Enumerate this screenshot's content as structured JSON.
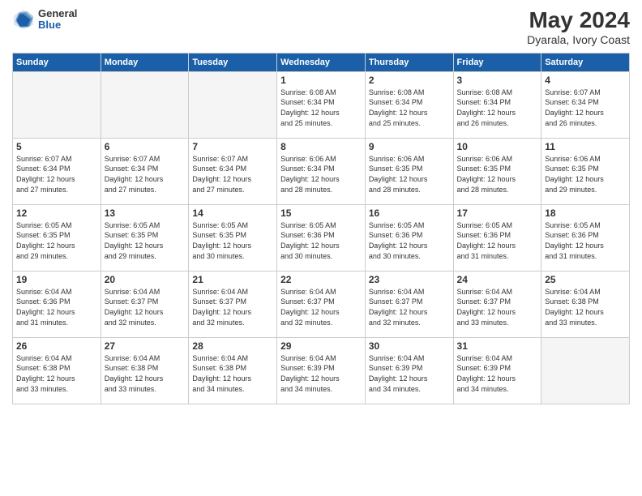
{
  "logo": {
    "general": "General",
    "blue": "Blue"
  },
  "title": "May 2024",
  "subtitle": "Dyarala, Ivory Coast",
  "days_of_week": [
    "Sunday",
    "Monday",
    "Tuesday",
    "Wednesday",
    "Thursday",
    "Friday",
    "Saturday"
  ],
  "weeks": [
    [
      {
        "day": "",
        "info": ""
      },
      {
        "day": "",
        "info": ""
      },
      {
        "day": "",
        "info": ""
      },
      {
        "day": "1",
        "info": "Sunrise: 6:08 AM\nSunset: 6:34 PM\nDaylight: 12 hours\nand 25 minutes."
      },
      {
        "day": "2",
        "info": "Sunrise: 6:08 AM\nSunset: 6:34 PM\nDaylight: 12 hours\nand 25 minutes."
      },
      {
        "day": "3",
        "info": "Sunrise: 6:08 AM\nSunset: 6:34 PM\nDaylight: 12 hours\nand 26 minutes."
      },
      {
        "day": "4",
        "info": "Sunrise: 6:07 AM\nSunset: 6:34 PM\nDaylight: 12 hours\nand 26 minutes."
      }
    ],
    [
      {
        "day": "5",
        "info": "Sunrise: 6:07 AM\nSunset: 6:34 PM\nDaylight: 12 hours\nand 27 minutes."
      },
      {
        "day": "6",
        "info": "Sunrise: 6:07 AM\nSunset: 6:34 PM\nDaylight: 12 hours\nand 27 minutes."
      },
      {
        "day": "7",
        "info": "Sunrise: 6:07 AM\nSunset: 6:34 PM\nDaylight: 12 hours\nand 27 minutes."
      },
      {
        "day": "8",
        "info": "Sunrise: 6:06 AM\nSunset: 6:34 PM\nDaylight: 12 hours\nand 28 minutes."
      },
      {
        "day": "9",
        "info": "Sunrise: 6:06 AM\nSunset: 6:35 PM\nDaylight: 12 hours\nand 28 minutes."
      },
      {
        "day": "10",
        "info": "Sunrise: 6:06 AM\nSunset: 6:35 PM\nDaylight: 12 hours\nand 28 minutes."
      },
      {
        "day": "11",
        "info": "Sunrise: 6:06 AM\nSunset: 6:35 PM\nDaylight: 12 hours\nand 29 minutes."
      }
    ],
    [
      {
        "day": "12",
        "info": "Sunrise: 6:05 AM\nSunset: 6:35 PM\nDaylight: 12 hours\nand 29 minutes."
      },
      {
        "day": "13",
        "info": "Sunrise: 6:05 AM\nSunset: 6:35 PM\nDaylight: 12 hours\nand 29 minutes."
      },
      {
        "day": "14",
        "info": "Sunrise: 6:05 AM\nSunset: 6:35 PM\nDaylight: 12 hours\nand 30 minutes."
      },
      {
        "day": "15",
        "info": "Sunrise: 6:05 AM\nSunset: 6:36 PM\nDaylight: 12 hours\nand 30 minutes."
      },
      {
        "day": "16",
        "info": "Sunrise: 6:05 AM\nSunset: 6:36 PM\nDaylight: 12 hours\nand 30 minutes."
      },
      {
        "day": "17",
        "info": "Sunrise: 6:05 AM\nSunset: 6:36 PM\nDaylight: 12 hours\nand 31 minutes."
      },
      {
        "day": "18",
        "info": "Sunrise: 6:05 AM\nSunset: 6:36 PM\nDaylight: 12 hours\nand 31 minutes."
      }
    ],
    [
      {
        "day": "19",
        "info": "Sunrise: 6:04 AM\nSunset: 6:36 PM\nDaylight: 12 hours\nand 31 minutes."
      },
      {
        "day": "20",
        "info": "Sunrise: 6:04 AM\nSunset: 6:37 PM\nDaylight: 12 hours\nand 32 minutes."
      },
      {
        "day": "21",
        "info": "Sunrise: 6:04 AM\nSunset: 6:37 PM\nDaylight: 12 hours\nand 32 minutes."
      },
      {
        "day": "22",
        "info": "Sunrise: 6:04 AM\nSunset: 6:37 PM\nDaylight: 12 hours\nand 32 minutes."
      },
      {
        "day": "23",
        "info": "Sunrise: 6:04 AM\nSunset: 6:37 PM\nDaylight: 12 hours\nand 32 minutes."
      },
      {
        "day": "24",
        "info": "Sunrise: 6:04 AM\nSunset: 6:37 PM\nDaylight: 12 hours\nand 33 minutes."
      },
      {
        "day": "25",
        "info": "Sunrise: 6:04 AM\nSunset: 6:38 PM\nDaylight: 12 hours\nand 33 minutes."
      }
    ],
    [
      {
        "day": "26",
        "info": "Sunrise: 6:04 AM\nSunset: 6:38 PM\nDaylight: 12 hours\nand 33 minutes."
      },
      {
        "day": "27",
        "info": "Sunrise: 6:04 AM\nSunset: 6:38 PM\nDaylight: 12 hours\nand 33 minutes."
      },
      {
        "day": "28",
        "info": "Sunrise: 6:04 AM\nSunset: 6:38 PM\nDaylight: 12 hours\nand 34 minutes."
      },
      {
        "day": "29",
        "info": "Sunrise: 6:04 AM\nSunset: 6:39 PM\nDaylight: 12 hours\nand 34 minutes."
      },
      {
        "day": "30",
        "info": "Sunrise: 6:04 AM\nSunset: 6:39 PM\nDaylight: 12 hours\nand 34 minutes."
      },
      {
        "day": "31",
        "info": "Sunrise: 6:04 AM\nSunset: 6:39 PM\nDaylight: 12 hours\nand 34 minutes."
      },
      {
        "day": "",
        "info": ""
      }
    ]
  ]
}
